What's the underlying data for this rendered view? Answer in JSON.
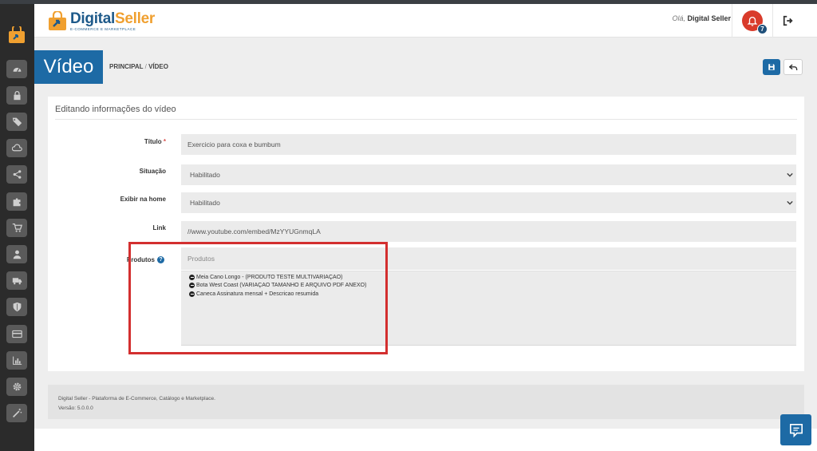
{
  "app": {
    "brand_name_part1": "Digital",
    "brand_name_part2": "Seller",
    "brand_tagline": "E-COMMERCE E MARKETPLACE"
  },
  "sidebar": {
    "items": [
      {
        "icon": "dashboard-icon"
      },
      {
        "icon": "lock-icon"
      },
      {
        "icon": "tags-icon"
      },
      {
        "icon": "cloud-icon"
      },
      {
        "icon": "share-icon"
      },
      {
        "icon": "puzzle-icon"
      },
      {
        "icon": "cart-icon"
      },
      {
        "icon": "user-icon"
      },
      {
        "icon": "truck-icon"
      },
      {
        "icon": "shield-icon"
      },
      {
        "icon": "credit-card-icon"
      },
      {
        "icon": "bar-chart-icon"
      },
      {
        "icon": "gear-icon"
      },
      {
        "icon": "magic-wand-icon"
      }
    ]
  },
  "header": {
    "greeting_prefix": "Olá,",
    "user_name": "Digital Seller",
    "notification_count": "7"
  },
  "page": {
    "title": "Vídeo",
    "breadcrumb_home": "PRINCIPAL",
    "breadcrumb_sep": "/",
    "breadcrumb_current": "VÍDEO"
  },
  "form": {
    "section_title": "Editando informações do vídeo",
    "titulo_label": "Título",
    "required_mark": "*",
    "titulo_value": "Exercicio para coxa e bumbum",
    "situacao_label": "Situação",
    "situacao_value": "Habilitado",
    "exibir_label": "Exibir na home",
    "exibir_value": "Habilitado",
    "link_label": "Link",
    "link_value": "//www.youtube.com/embed/MzYYUGnmqLA",
    "produtos_label": "Produtos",
    "help_glyph": "?",
    "produtos_placeholder": "Produtos",
    "produtos_selected": [
      "Meia Cano Longo - (PRODUTO TESTE MULTIVARIAÇAO)",
      "Bota West Coast (VARIAÇAO TAMANHO E ARQUIVO PDF ANEXO)",
      "Caneca Assinatura mensal + Descricao resumida"
    ]
  },
  "footer": {
    "line1": "Digital Seller - Plataforma de E-Commerce, Catálogo e Marketplace.",
    "line2": "Versão: 5.0.0.0"
  },
  "colors": {
    "primary": "#1d6aa5",
    "sidebar_bg": "#2b2b2b",
    "notification": "#d93b2b",
    "highlight": "#d32f2f"
  }
}
